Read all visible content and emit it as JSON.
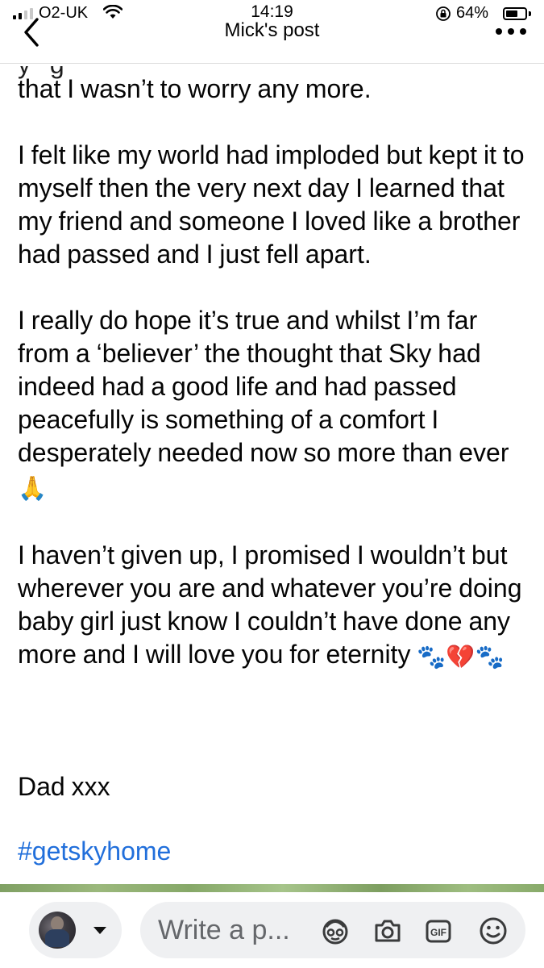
{
  "status_bar": {
    "carrier": "O2-UK",
    "time": "14:19",
    "battery_percent": "64%",
    "battery_level": 0.64,
    "signal_bars": 2,
    "icons": [
      "signal-icon",
      "wifi-icon",
      "orientation-lock-icon",
      "battery-icon"
    ]
  },
  "nav": {
    "title": "Mick's post",
    "back_icon": "chevron-left-icon",
    "more_icon": "more-dots-icon"
  },
  "post": {
    "cut_line": "that I wasn’t to worry any more.",
    "paragraphs": [
      "I felt like my world had imploded but kept it to myself then the very next day I learned that my friend and someone I loved like a brother had passed and I just fell apart.",
      "I really do hope it’s true and whilst I’m far from a ‘believer’ the thought that Sky had indeed had a good life and had passed peacefully is something of a comfort I desperately needed now so more than ever",
      "I haven’t given up, I promised I wouldn’t but wherever you are and whatever you’re doing baby girl just know I couldn’t have done any more and I will love you for eternity"
    ],
    "emoji_after_paragraph_2": "🙏",
    "emoji_after_paragraph_3": "🐾💔🐾",
    "sign_off": "Dad xxx",
    "hashtag": "#getskyhome"
  },
  "composer": {
    "placeholder": "Write a p...",
    "icons": [
      "avatar",
      "caret-down-icon",
      "avatar-sticker-icon",
      "camera-icon",
      "gif-icon",
      "smiley-icon"
    ],
    "gif_label": "GIF"
  },
  "colors": {
    "text": "#050505",
    "link": "#216fdb",
    "input_bg": "#eff0f2",
    "placeholder": "#65676b"
  }
}
